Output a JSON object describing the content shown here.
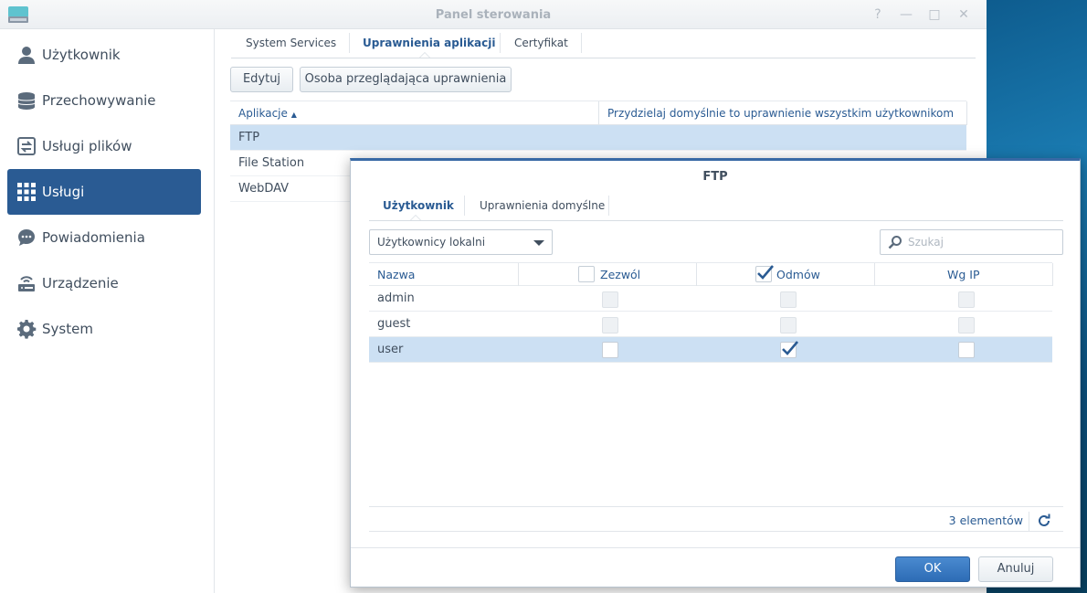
{
  "window": {
    "title": "Panel sterowania",
    "controls": {
      "help": "?",
      "minimize": "—",
      "maximize": "□",
      "close": "✕"
    }
  },
  "sidebar": {
    "items": [
      {
        "label": "Użytkownik",
        "icon": "user-icon"
      },
      {
        "label": "Przechowywanie",
        "icon": "storage-icon"
      },
      {
        "label": "Usługi plików",
        "icon": "file-services-icon"
      },
      {
        "label": "Usługi",
        "icon": "apps-grid-icon",
        "active": true
      },
      {
        "label": "Powiadomienia",
        "icon": "chat-bubble-icon"
      },
      {
        "label": "Urządzenie",
        "icon": "router-icon"
      },
      {
        "label": "System",
        "icon": "gear-icon"
      }
    ]
  },
  "main": {
    "tabs": [
      "System Services",
      "Uprawnienia aplikacji",
      "Certyfikat"
    ],
    "active_tab": 1,
    "toolbar": {
      "edit": "Edytuj",
      "viewer": "Osoba przeglądająca uprawnienia"
    },
    "grid": {
      "columns": [
        "Aplikacje",
        "Przydzielaj domyślnie to uprawnienie wszystkim użytkownikom"
      ],
      "rows": [
        "FTP",
        "File Station",
        "WebDAV"
      ],
      "selected_row": 0
    }
  },
  "dialog": {
    "title": "FTP",
    "tabs": [
      "Użytkownik",
      "Uprawnienia domyślne"
    ],
    "active_tab": 0,
    "filter": {
      "value": "Użytkownicy lokalni"
    },
    "search": {
      "placeholder": "Szukaj"
    },
    "columns": {
      "name": "Nazwa",
      "allow": "Zezwól",
      "deny": "Odmów",
      "by_ip": "Wg IP"
    },
    "header_checks": {
      "allow": false,
      "deny": true
    },
    "rows": [
      {
        "name": "admin",
        "allow": false,
        "deny": false,
        "by_ip": false,
        "disabled": true
      },
      {
        "name": "guest",
        "allow": false,
        "deny": false,
        "by_ip": false,
        "disabled": true
      },
      {
        "name": "user",
        "allow": false,
        "deny": true,
        "by_ip": false,
        "disabled": false,
        "selected": true
      }
    ],
    "count": "3 elementów",
    "buttons": {
      "ok": "OK",
      "cancel": "Anuluj"
    },
    "colors": {
      "accent": "#2a5b93",
      "selected_row": "#cce0f3",
      "ok_button": "#2d6cb5"
    }
  }
}
